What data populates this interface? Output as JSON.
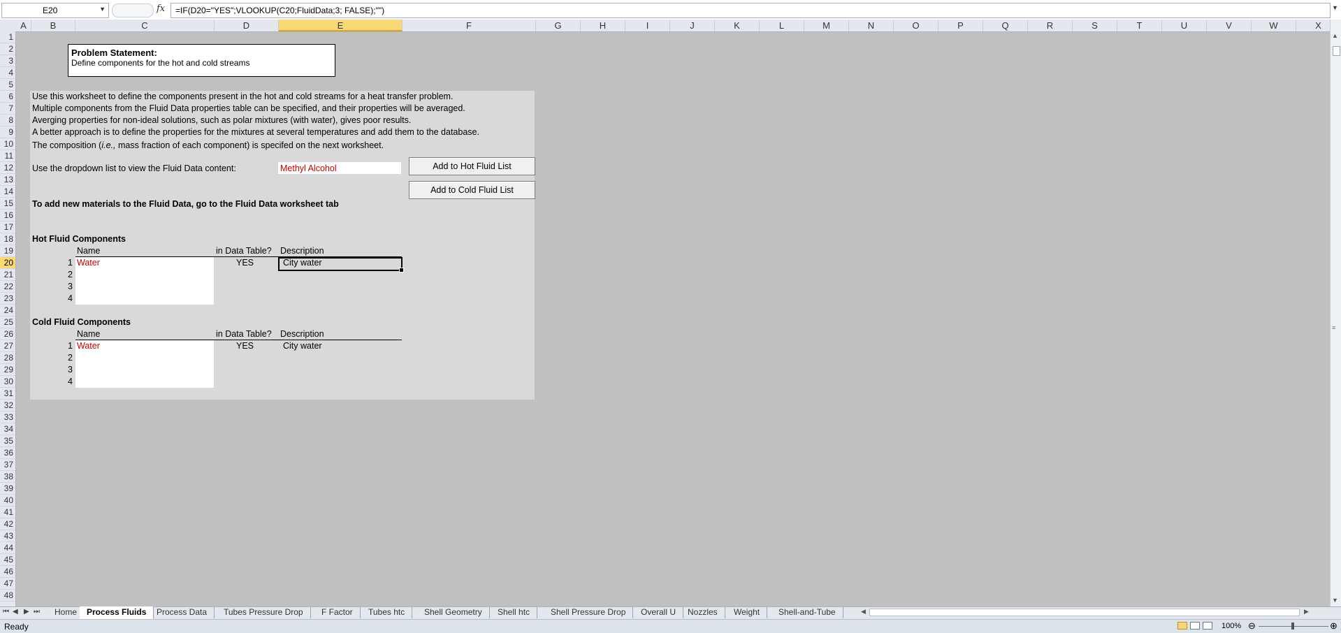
{
  "formula_bar": {
    "name_box": "E20",
    "formula": "=IF(D20=\"YES\";VLOOKUP(C20;FluidData;3; FALSE);\"\")"
  },
  "columns": [
    "A",
    "B",
    "C",
    "D",
    "E",
    "F",
    "G",
    "H",
    "I",
    "J",
    "K",
    "L",
    "M",
    "N",
    "O",
    "P",
    "Q",
    "R",
    "S",
    "T",
    "U",
    "V",
    "W",
    "X"
  ],
  "selected_column": "E",
  "rows": [
    "1",
    "2",
    "3",
    "4",
    "5",
    "6",
    "7",
    "8",
    "9",
    "10",
    "11",
    "12",
    "13",
    "14",
    "15",
    "16",
    "17",
    "18",
    "19",
    "20",
    "21",
    "22",
    "23",
    "24",
    "25",
    "26",
    "27",
    "28",
    "29",
    "30",
    "31",
    "32",
    "33",
    "34",
    "35",
    "36",
    "37",
    "38",
    "39",
    "40",
    "41",
    "42",
    "43",
    "44",
    "45",
    "46",
    "47",
    "48"
  ],
  "selected_row": "20",
  "problem": {
    "title": "Problem Statement:",
    "text": "Define  components  for the hot and cold streams"
  },
  "intro_lines": [
    "Use this worksheet to define the components present in the hot and cold streams for a heat transfer problem.",
    "Multiple components from the Fluid Data properties table can be specified, and their properties will be averaged.",
    "Averging properties for non-ideal solutions, such as polar mixtures (with water), gives poor results.",
    "A better approach is to define the properties for the mixtures at several temperatures and add them to the database."
  ],
  "composition_line": {
    "prefix": "The composition (",
    "italic": "i.e.,",
    "suffix": "  mass fraction of each component) is specifed on the next worksheet."
  },
  "dropdown": {
    "label": "Use the dropdown list to view the Fluid Data content:",
    "value": "Methyl Alcohol"
  },
  "buttons": {
    "add_hot": "Add to Hot Fluid List",
    "add_cold": "Add to Cold Fluid List"
  },
  "add_new_note": "To add new materials to the Fluid Data, go to the Fluid Data worksheet tab",
  "hot": {
    "title": "Hot Fluid Components",
    "headers": {
      "name": "Name",
      "in_table": "in Data Table?",
      "description": "Description"
    },
    "rows": [
      {
        "idx": "1",
        "name": "Water",
        "in_table": "YES",
        "description": "City water"
      },
      {
        "idx": "2",
        "name": "",
        "in_table": "",
        "description": ""
      },
      {
        "idx": "3",
        "name": "",
        "in_table": "",
        "description": ""
      },
      {
        "idx": "4",
        "name": "",
        "in_table": "",
        "description": ""
      }
    ]
  },
  "cold": {
    "title": "Cold Fluid Components",
    "headers": {
      "name": "Name",
      "in_table": "in Data Table?",
      "description": "Description"
    },
    "rows": [
      {
        "idx": "1",
        "name": "Water",
        "in_table": "YES",
        "description": "City water"
      },
      {
        "idx": "2",
        "name": "",
        "in_table": "",
        "description": ""
      },
      {
        "idx": "3",
        "name": "",
        "in_table": "",
        "description": ""
      },
      {
        "idx": "4",
        "name": "",
        "in_table": "",
        "description": ""
      }
    ]
  },
  "tabs": [
    "Home",
    "Process Fluids",
    "Process Data",
    "Tubes Pressure Drop",
    "F Factor",
    "Tubes htc",
    "Shell Geometry",
    "Shell htc",
    "Shell Pressure Drop",
    "Overall U",
    "Nozzles",
    "Weight",
    "Shell-and-Tube"
  ],
  "active_tab": "Process Fluids",
  "status": {
    "ready": "Ready",
    "zoom": "100%"
  },
  "colors": {
    "accent_red": "#c00000",
    "selection_header": "#f9d977",
    "panel_bg": "#d9d9d9"
  }
}
